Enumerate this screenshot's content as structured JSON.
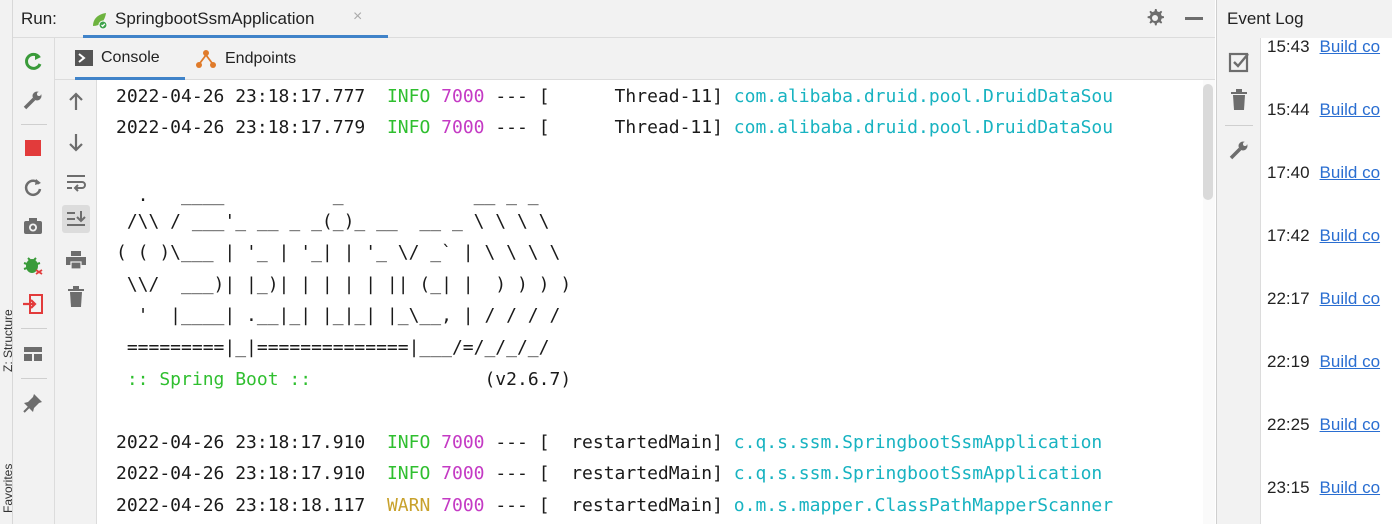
{
  "side_strip": {
    "labels": [
      "Z: Structure",
      "Favorites"
    ]
  },
  "run_header": {
    "label": "Run:",
    "tab_title": "SpringbootSsmApplication",
    "close_glyph": "×"
  },
  "console_tabs": [
    {
      "label": "Console"
    },
    {
      "label": "Endpoints"
    }
  ],
  "console": {
    "log_top": [
      {
        "ts": "2022-04-26 23:18:17.777",
        "level": "INFO",
        "pid": "7000",
        "sep": "---",
        "thread": "[      Thread-11]",
        "logger": "com.alibaba.druid.pool.DruidDataSou"
      },
      {
        "ts": "2022-04-26 23:18:17.779",
        "level": "INFO",
        "pid": "7000",
        "sep": "---",
        "thread": "[      Thread-11]",
        "logger": "com.alibaba.druid.pool.DruidDataSou"
      }
    ],
    "banner": [
      "  .   ____          _            __ _ _",
      " /\\\\ / ___'_ __ _ _(_)_ __  __ _ \\ \\ \\ \\",
      "( ( )\\___ | '_ | '_| | '_ \\/ _` | \\ \\ \\ \\",
      " \\\\/  ___)| |_)| | | | | || (_| |  ) ) ) )",
      "  '  |____| .__|_| |_|_| |_\\__, | / / / /",
      " =========|_|==============|___/=/_/_/_/"
    ],
    "spring_boot_label": " :: Spring Boot ::",
    "spring_boot_version": "(v2.6.7)",
    "log_bottom": [
      {
        "ts": "2022-04-26 23:18:17.910",
        "level": "INFO",
        "pid": "7000",
        "sep": "---",
        "thread": "[  restartedMain]",
        "logger": "c.q.s.ssm.SpringbootSsmApplication"
      },
      {
        "ts": "2022-04-26 23:18:17.910",
        "level": "INFO",
        "pid": "7000",
        "sep": "---",
        "thread": "[  restartedMain]",
        "logger": "c.q.s.ssm.SpringbootSsmApplication"
      },
      {
        "ts": "2022-04-26 23:18:18.117",
        "level": "WARN",
        "pid": "7000",
        "sep": "---",
        "thread": "[  restartedMain]",
        "logger": "o.m.s.mapper.ClassPathMapperScanner"
      }
    ]
  },
  "event_log": {
    "title": "Event Log",
    "entries": [
      {
        "time": "15:43",
        "link": "Build co"
      },
      {
        "time": "15:44",
        "link": "Build co"
      },
      {
        "time": "17:40",
        "link": "Build co"
      },
      {
        "time": "17:42",
        "link": "Build co"
      },
      {
        "time": "22:17",
        "link": "Build co"
      },
      {
        "time": "22:19",
        "link": "Build co"
      },
      {
        "time": "22:25",
        "link": "Build co"
      },
      {
        "time": "23:15",
        "link": "Build co"
      }
    ]
  },
  "colors": {
    "accent": "#4083c9",
    "info": "#2fbf2f",
    "warn": "#c8a12b",
    "pid": "#c43ac4",
    "logger": "#18b3c1",
    "link": "#2a6ed1"
  }
}
